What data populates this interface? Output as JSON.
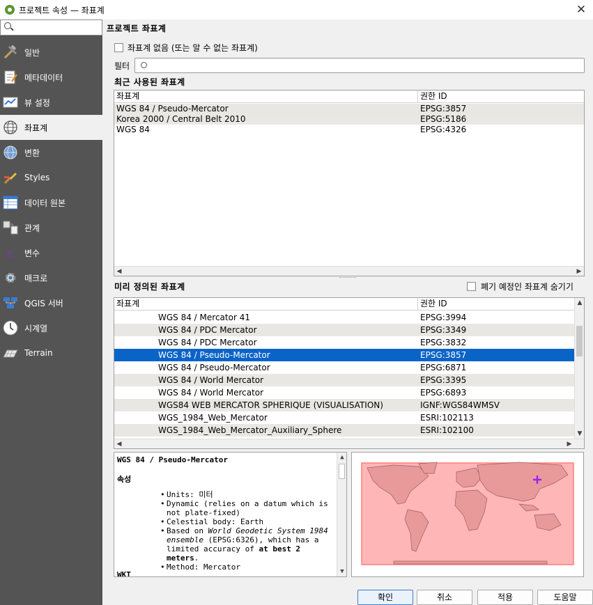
{
  "window": {
    "title": "프로젝트 속성 — 좌표계"
  },
  "search": {
    "placeholder": ""
  },
  "sidebar": {
    "items": [
      {
        "label": "일반",
        "icon": "tools-icon"
      },
      {
        "label": "메타데이터",
        "icon": "metadata-icon"
      },
      {
        "label": "뷰 설정",
        "icon": "view-settings-icon"
      },
      {
        "label": "좌표계",
        "icon": "globe-icon"
      },
      {
        "label": "변환",
        "icon": "transform-icon"
      },
      {
        "label": "Styles",
        "icon": "styles-icon"
      },
      {
        "label": "데이터 원본",
        "icon": "data-sources-icon"
      },
      {
        "label": "관계",
        "icon": "relations-icon"
      },
      {
        "label": "변수",
        "icon": "variables-icon"
      },
      {
        "label": "매크로",
        "icon": "macros-icon"
      },
      {
        "label": "QGIS 서버",
        "icon": "qgis-server-icon"
      },
      {
        "label": "시계열",
        "icon": "temporal-icon"
      },
      {
        "label": "Terrain",
        "icon": "terrain-icon"
      }
    ],
    "selected": "좌표계"
  },
  "main": {
    "section_title": "프로젝트 좌표계",
    "no_crs_label": "좌표계 없음 (또는 알 수 없는 좌표계)",
    "filter_label": "필터",
    "recent_title": "최근 사용된 좌표계",
    "predefined_title": "미리 정의된 좌표계",
    "hide_deprecated_label": "폐기 예정인 좌표계 숨기기",
    "columns": {
      "crs": "좌표계",
      "authority": "권한 ID"
    },
    "recent": [
      {
        "name": "WGS 84 / Pseudo-Mercator",
        "id": "EPSG:3857"
      },
      {
        "name": "Korea 2000 / Central Belt 2010",
        "id": "EPSG:5186"
      },
      {
        "name": "WGS 84",
        "id": "EPSG:4326"
      }
    ],
    "predefined": [
      {
        "name": "WGS 84 / Mercator 41",
        "id": "EPSG:3994"
      },
      {
        "name": "WGS 84 / PDC Mercator",
        "id": "EPSG:3349"
      },
      {
        "name": "WGS 84 / PDC Mercator",
        "id": "EPSG:3832"
      },
      {
        "name": "WGS 84 / Pseudo-Mercator",
        "id": "EPSG:3857"
      },
      {
        "name": "WGS 84 / Pseudo-Mercator",
        "id": "EPSG:6871"
      },
      {
        "name": "WGS 84 / World Mercator",
        "id": "EPSG:3395"
      },
      {
        "name": "WGS 84 / World Mercator",
        "id": "EPSG:6893"
      },
      {
        "name": "WGS84 WEB MERCATOR SPHERIQUE (VISUALISATION)",
        "id": "IGNF:WGS84WMSV"
      },
      {
        "name": "WGS_1984_Web_Mercator",
        "id": "ESRI:102113"
      },
      {
        "name": "WGS_1984_Web_Mercator_Auxiliary_Sphere",
        "id": "ESRI:102100"
      }
    ],
    "selected_predefined": "EPSG:3857",
    "details": {
      "title": "WGS 84 / Pseudo-Mercator",
      "props_heading": "속성",
      "units": "Units: 미터",
      "dynamic": "Dynamic (relies on a datum which is not plate-fixed)",
      "celestial": "Celestial body: Earth",
      "based_prefix": "Based on ",
      "based_italic": "World Geodetic System 1984 ensemble",
      "based_mid": " (EPSG:6326), which has a limited accuracy of ",
      "based_bold": "at best 2 meters",
      "based_end": ".",
      "method": "Method: Mercator",
      "wkt_heading": "WKT"
    }
  },
  "buttons": {
    "ok": "확인",
    "cancel": "취소",
    "apply": "적용",
    "help": "도움말"
  },
  "colors": {
    "selection": "#0a64c8",
    "sidebar": "#545454",
    "extent": "#ff9c9c",
    "marker": "#a020f0"
  }
}
